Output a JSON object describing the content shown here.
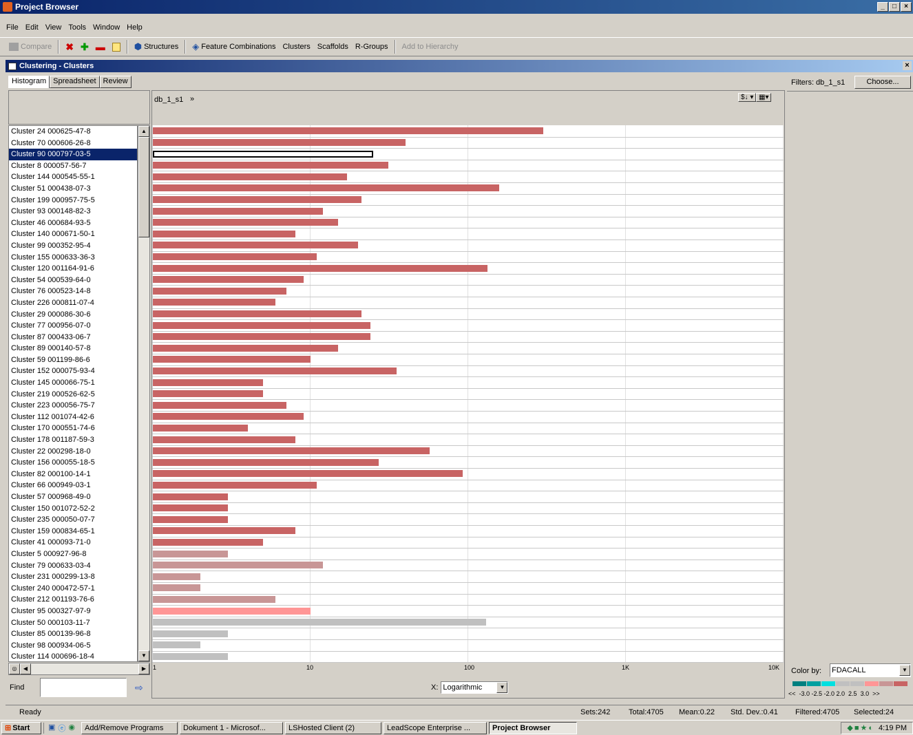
{
  "window": {
    "title": "Project Browser"
  },
  "menu": [
    "File",
    "Edit",
    "View",
    "Tools",
    "Window",
    "Help"
  ],
  "toolbar": {
    "compare": "Compare",
    "structures": "Structures",
    "feature_combinations": "Feature Combinations",
    "clusters": "Clusters",
    "scaffolds": "Scaffolds",
    "rgroups": "R-Groups",
    "add_to_hierarchy": "Add to Hierarchy"
  },
  "panel": {
    "title": "Clustering - Clusters"
  },
  "tabs": [
    "Histogram",
    "Spreadsheet",
    "Review"
  ],
  "chart_header": {
    "dataset": "db_1_s1",
    "chevron": "»",
    "sort_label": "$↓"
  },
  "find": {
    "label": "Find",
    "value": ""
  },
  "xaxis": {
    "label": "X:",
    "scale": "Logarithmic"
  },
  "filters": {
    "label": "Filters: db_1_s1",
    "choose": "Choose..."
  },
  "color_by": {
    "label": "Color by:",
    "value": "FDACALL",
    "scale_labels": "<<  -3.0 -2.5 -2.0 2.0  2.5  3.0  >>"
  },
  "status": {
    "ready": "Ready",
    "sets": "Sets:242",
    "total": "Total:4705",
    "mean": "Mean:0.22",
    "std": "Std. Dev.:0.41",
    "filtered": "Filtered:4705",
    "selected": "Selected:24"
  },
  "taskbar": {
    "start": "Start",
    "items": [
      "Add/Remove Programs",
      "Dokument 1 - Microsof...",
      "LSHosted Client (2)",
      "LeadScope Enterprise ...",
      "Project Browser"
    ],
    "clock": "4:19 PM"
  },
  "chart_data": {
    "type": "bar",
    "orientation": "horizontal",
    "xscale": "log",
    "xlim": [
      1,
      10000
    ],
    "xticks": [
      "1",
      "10",
      "100",
      "1K",
      "10K"
    ],
    "categories": [
      "Cluster 24 000625-47-8",
      "Cluster 70 000606-26-8",
      "Cluster 90 000797-03-5",
      "Cluster 8 000057-56-7",
      "Cluster 144 000545-55-1",
      "Cluster 51 000438-07-3",
      "Cluster 199 000957-75-5",
      "Cluster 93 000148-82-3",
      "Cluster 46 000684-93-5",
      "Cluster 140 000671-50-1",
      "Cluster 99 000352-95-4",
      "Cluster 155 000633-36-3",
      "Cluster 120 001164-91-6",
      "Cluster 54 000539-64-0",
      "Cluster 76 000523-14-8",
      "Cluster 226 000811-07-4",
      "Cluster 29 000086-30-6",
      "Cluster 77 000956-07-0",
      "Cluster 87 000433-06-7",
      "Cluster 89 000140-57-8",
      "Cluster 59 001199-86-6",
      "Cluster 152 000075-93-4",
      "Cluster 145 000066-75-1",
      "Cluster 219 000526-62-5",
      "Cluster 223 000056-75-7",
      "Cluster 112 001074-42-6",
      "Cluster 170 000551-74-6",
      "Cluster 178 001187-59-3",
      "Cluster 22 000298-18-0",
      "Cluster 156 000055-18-5",
      "Cluster 82 000100-14-1",
      "Cluster 66 000949-03-1",
      "Cluster 57 000968-49-0",
      "Cluster 150 001072-52-2",
      "Cluster 235 000050-07-7",
      "Cluster 159 000834-65-1",
      "Cluster 41 000093-71-0",
      "Cluster 5 000927-96-8",
      "Cluster 79 000633-03-4",
      "Cluster 231 000299-13-8",
      "Cluster 240 000472-57-1",
      "Cluster 212 001193-76-6",
      "Cluster 95 000327-97-9",
      "Cluster 50 000103-11-7",
      "Cluster 85 000139-96-8",
      "Cluster 98 000934-06-5",
      "Cluster 114 000696-18-4"
    ],
    "values": [
      300,
      40,
      25,
      31,
      17,
      157,
      21,
      12,
      15,
      8,
      20,
      11,
      132,
      9,
      7,
      6,
      21,
      24,
      24,
      15,
      10,
      35,
      5,
      5,
      7,
      9,
      4,
      8,
      57,
      27,
      92,
      11,
      3,
      3,
      3,
      8,
      5,
      3,
      12,
      2,
      2,
      6,
      10,
      130,
      3,
      2,
      3
    ],
    "colors": [
      "#c86464",
      "#c86464",
      "#ffffff",
      "#c86464",
      "#c86464",
      "#c86464",
      "#c86464",
      "#c86464",
      "#c86464",
      "#c86464",
      "#c86464",
      "#c86464",
      "#c86464",
      "#c86464",
      "#c86464",
      "#c86464",
      "#c86464",
      "#c86464",
      "#c86464",
      "#c86464",
      "#c86464",
      "#c86464",
      "#c86464",
      "#c86464",
      "#c86464",
      "#c86464",
      "#c86464",
      "#c86464",
      "#c86464",
      "#c86464",
      "#c86464",
      "#c86464",
      "#c86464",
      "#c86464",
      "#c86464",
      "#c86464",
      "#c86464",
      "#c89696",
      "#c89696",
      "#c89696",
      "#c89696",
      "#c89696",
      "#ff9696",
      "#c0c0c0",
      "#c0c0c0",
      "#c0c0c0",
      "#c0c0c0"
    ],
    "selected_index": 2,
    "legend_colors": [
      "#008080",
      "#00a0a0",
      "#00e0e0",
      "#c0c0c0",
      "#c0c0c0",
      "#ff9696",
      "#c89696",
      "#c86464"
    ]
  }
}
